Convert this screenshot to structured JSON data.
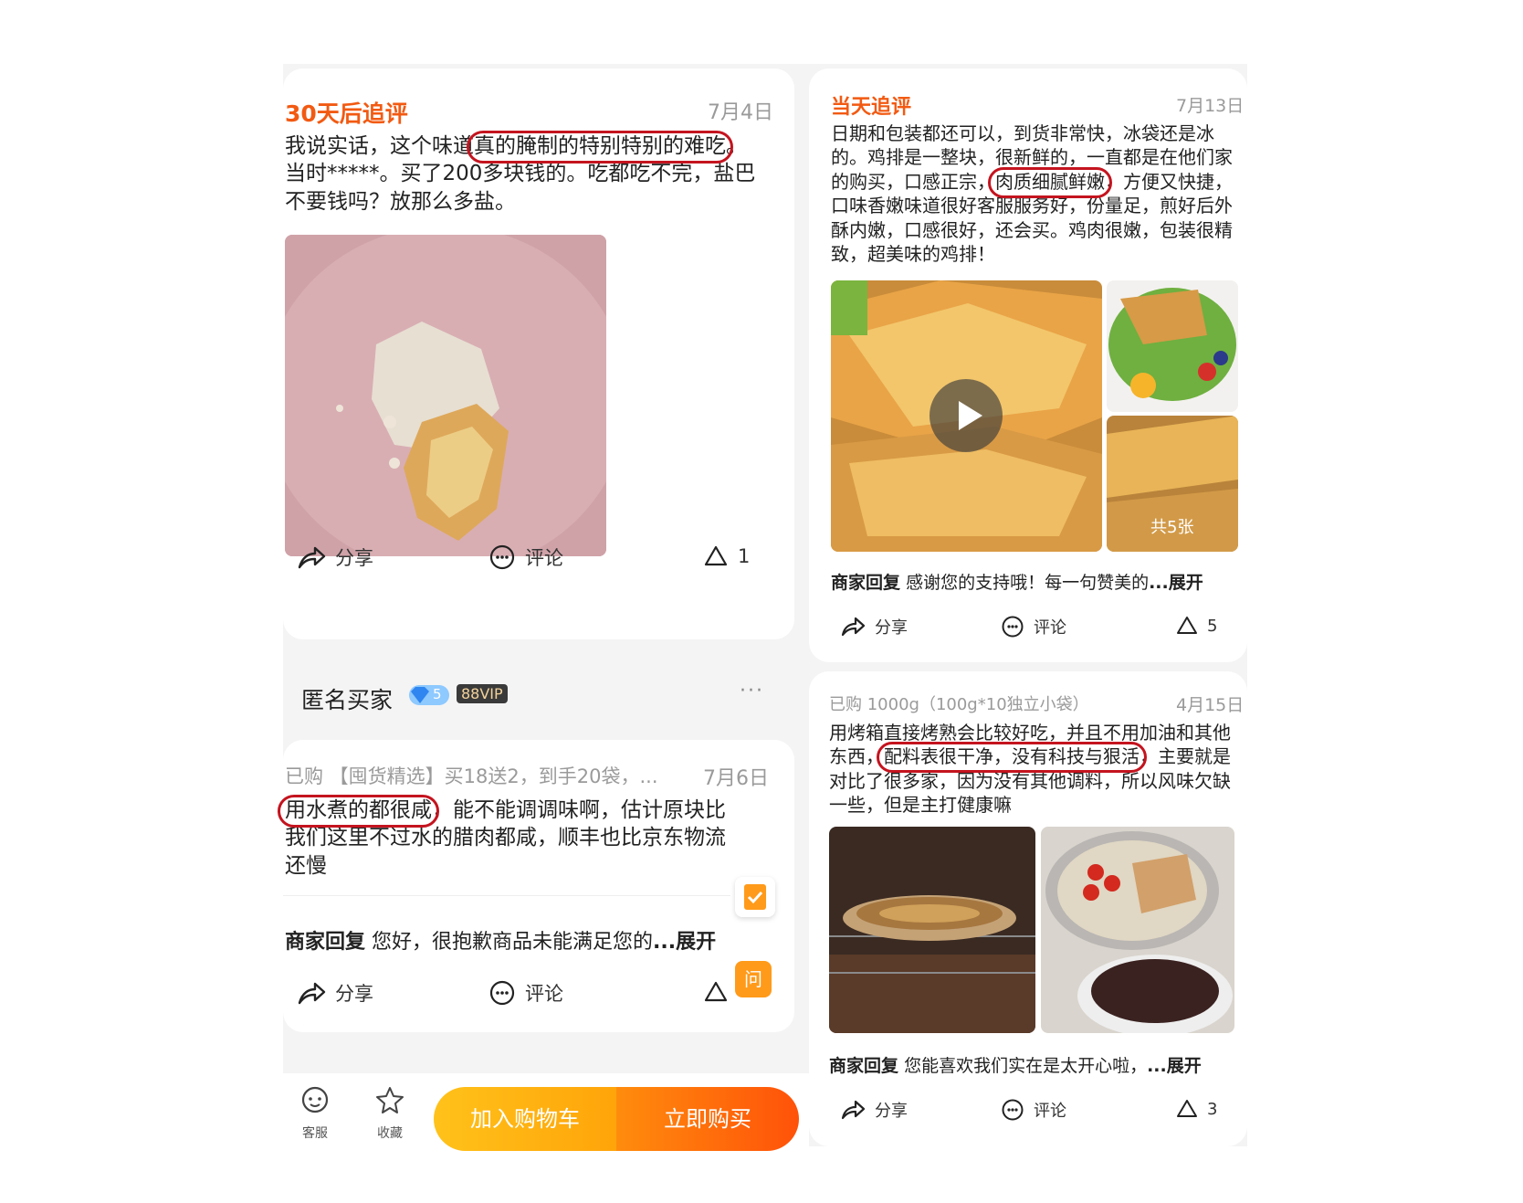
{
  "left": {
    "review1": {
      "tag": "30天后追评",
      "date": "7月4日",
      "text_before": "我说实话，这个味道",
      "text_hl": "真的腌制的特别特别的难吃",
      "text_after": "。当时*****。买了200多块钱的。吃都吃不完，盐巴不要钱吗？放那么多盐。",
      "share": "分享",
      "comment": "评论",
      "likes": "1"
    },
    "reviewer2": {
      "name": "匿名买家",
      "level": "5",
      "vip": "88VIP",
      "more": "···"
    },
    "review2": {
      "purchased": "已购 【囤货精选】买18送2，到手20袋，...",
      "date": "7月6日",
      "text_hl": "用水煮的都很咸",
      "text_after": "，能不能调调味啊，估计原块比我们这里不过水的腊肉都咸，顺丰也比京东物流还慢",
      "merchant_label": "商家回复",
      "merchant_text": "您好，很抱歉商品未能满足您的",
      "expand": "...展开",
      "share": "分享",
      "comment": "评论",
      "ask": "问"
    },
    "bottom_bar": {
      "service": "客服",
      "favorite": "收藏",
      "add_cart": "加入购物车",
      "buy_now": "立即购买"
    }
  },
  "right": {
    "review1": {
      "tag": "当天追评",
      "date": "7月13日",
      "text_before": "日期和包装都还可以，到货非常快，冰袋还是冰的。鸡排是一整块，很新鲜的，一直都是在他们家的购买，口感正宗，",
      "text_hl": "肉质细腻鲜嫩",
      "text_after": "，方便又快捷，口味香嫩味道很好客服服务好，份量足，煎好后外酥内嫩，口感很好，还会买。鸡肉很嫩，包装很精致，超美味的鸡排！",
      "photo_count": "共5张",
      "merchant_label": "商家回复",
      "merchant_text": "感谢您的支持哦！每一句赞美的",
      "expand": "...展开",
      "share": "分享",
      "comment": "评论",
      "likes": "5"
    },
    "review2": {
      "purchased": "已购 1000g（100g*10独立小袋）",
      "date": "4月15日",
      "text_before": "用烤箱直接烤熟会比较好吃，并且不用加油和其他东西，",
      "text_hl": "配料表很干净，没有科技与狠活",
      "text_after": "，主要就是对比了很多家，因为没有其他调料，所以风味欠缺一些，但是主打健康嘛",
      "merchant_label": "商家回复",
      "merchant_text": "您能喜欢我们实在是太开心啦，",
      "expand": "...展开",
      "share": "分享",
      "comment": "评论",
      "likes": "3"
    }
  },
  "colors": {
    "accent_orange": "#f25a12",
    "highlight_red": "#c4141f",
    "cart_yellow": "#ffb412",
    "buy_orange": "#ff6a0a"
  }
}
